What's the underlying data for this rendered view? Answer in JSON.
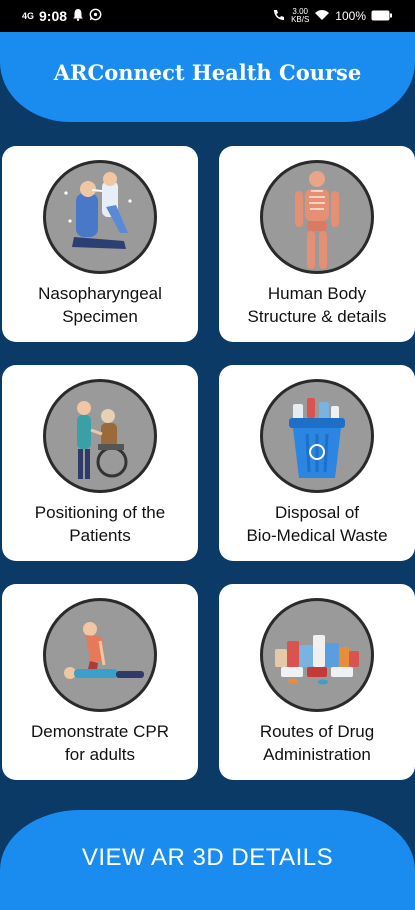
{
  "status_bar": {
    "network": "4G",
    "time": "9:08",
    "net_speed_value": "3.00",
    "net_speed_unit": "KB/S",
    "battery": "100%"
  },
  "header": {
    "title": "ARConnect Health Course"
  },
  "cards": [
    {
      "line1": "Nasopharyngeal",
      "line2": "Specimen",
      "icon": "nasal-swab-illustration"
    },
    {
      "line1": "Human Body",
      "line2": "Structure & details",
      "icon": "skeleton-illustration"
    },
    {
      "line1": "Positioning of the",
      "line2": "Patients",
      "icon": "patient-wheelchair-illustration"
    },
    {
      "line1": "Disposal of",
      "line2": "Bio-Medical Waste",
      "icon": "waste-bin-illustration"
    },
    {
      "line1": "Demonstrate CPR",
      "line2": "for adults",
      "icon": "cpr-illustration"
    },
    {
      "line1": "Routes of Drug",
      "line2": "Administration",
      "icon": "medicine-bottles-illustration"
    }
  ],
  "bottom_button": {
    "label": "VIEW AR 3D DETAILS"
  }
}
